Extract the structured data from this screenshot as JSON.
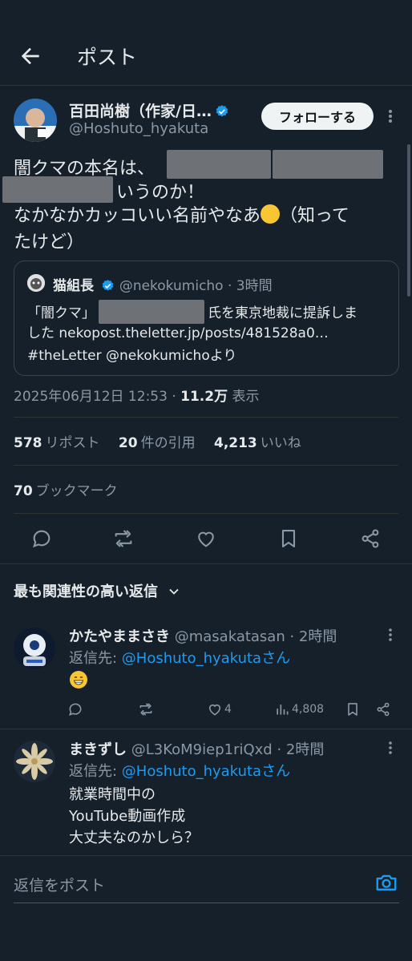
{
  "header": {
    "title": "ポスト"
  },
  "post": {
    "author_name": "百田尚樹（作家/日…",
    "author_handle": "@Hoshuto_hyakuta",
    "follow_label": "フォローする",
    "text_line1": "闇クマの本名は、",
    "text_line2": "いうのか！",
    "text_line3": "なかなかカッコいい名前やなあ",
    "text_line3_after": "（知って",
    "text_line4": "たけど）",
    "quote": {
      "name": "猫組長",
      "handle": "@nekokumicho",
      "time": "· 3時間",
      "line1_a": "「闇クマ」",
      "line1_b": "氏を東京地裁に提訴しま",
      "line2": "した nekopost.theletter.jp/posts/481528a0…",
      "line3": "#theLetter @nekokumichoより"
    },
    "timestamp": "2025年06月12日 12:53 · ",
    "views_count": "11.2万",
    "views_label": "表示",
    "reposts_count": "578",
    "reposts_label": "リポスト",
    "quotes_count": "20",
    "quotes_label": "件の引用",
    "likes_count": "4,213",
    "likes_label": "いいね",
    "bookmarks_count": "70",
    "bookmarks_label": "ブックマーク"
  },
  "replies_sort_label": "最も関連性の高い返信",
  "replies": [
    {
      "name": "かたやままさき",
      "handle": "@masakatasan",
      "time": "· 2時間",
      "reply_to_prefix": "返信先: ",
      "reply_to_handle": "@Hoshuto_hyakutaさん",
      "likes": "4",
      "views": "4,808"
    },
    {
      "name": "まきずし",
      "handle": "@L3KoM9iep1riQxd",
      "time": "· 2時間",
      "reply_to_prefix": "返信先: ",
      "reply_to_handle": "@Hoshuto_hyakutaさん",
      "text_line1": "就業時間中の",
      "text_line2": "YouTube動画作成",
      "text_line3": "大丈夫なのかしら？"
    }
  ],
  "compose": {
    "placeholder": "返信をポスト"
  },
  "colors": {
    "background": "#15202b",
    "accent": "#1d9bf0",
    "muted": "#8b98a5"
  },
  "icons": [
    "back-arrow-icon",
    "verified-badge-icon",
    "more-icon",
    "reply-icon",
    "repost-icon",
    "like-icon",
    "bookmark-icon",
    "share-icon",
    "chevron-down-icon",
    "views-icon",
    "camera-icon"
  ]
}
